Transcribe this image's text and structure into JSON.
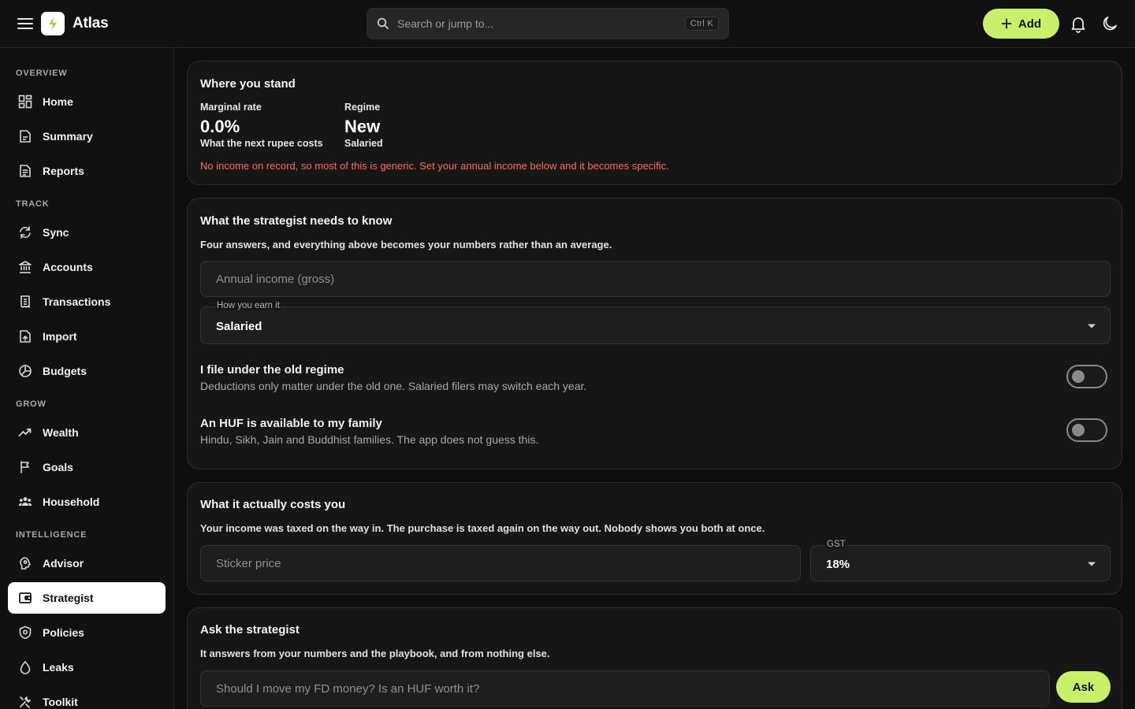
{
  "app": {
    "name": "Atlas",
    "search_placeholder": "Search or jump to...",
    "search_shortcut": "Ctrl K",
    "add_label": "Add"
  },
  "colors": {
    "accent": "#c8f06a",
    "warning": "#ff6b5b",
    "background": "#0e0e0e",
    "card": "#161616"
  },
  "sidebar": {
    "sections": [
      {
        "label": "OVERVIEW",
        "items": [
          {
            "label": "Home",
            "icon": "grid-icon"
          },
          {
            "label": "Summary",
            "icon": "document-icon"
          },
          {
            "label": "Reports",
            "icon": "report-icon"
          }
        ]
      },
      {
        "label": "TRACK",
        "items": [
          {
            "label": "Sync",
            "icon": "sync-icon"
          },
          {
            "label": "Accounts",
            "icon": "bank-icon"
          },
          {
            "label": "Transactions",
            "icon": "receipt-icon"
          },
          {
            "label": "Import",
            "icon": "import-icon"
          },
          {
            "label": "Budgets",
            "icon": "pie-icon"
          }
        ]
      },
      {
        "label": "GROW",
        "items": [
          {
            "label": "Wealth",
            "icon": "trend-icon"
          },
          {
            "label": "Goals",
            "icon": "flag-icon"
          },
          {
            "label": "Household",
            "icon": "people-icon"
          }
        ]
      },
      {
        "label": "INTELLIGENCE",
        "items": [
          {
            "label": "Advisor",
            "icon": "brain-icon"
          },
          {
            "label": "Strategist",
            "icon": "wallet-icon",
            "active": true
          },
          {
            "label": "Policies",
            "icon": "shield-icon"
          },
          {
            "label": "Leaks",
            "icon": "drop-icon"
          },
          {
            "label": "Toolkit",
            "icon": "tools-icon"
          }
        ]
      }
    ]
  },
  "stand": {
    "title": "Where you stand",
    "marginal_label": "Marginal rate",
    "marginal_value": "0.0%",
    "marginal_note": "What the next rupee costs",
    "regime_label": "Regime",
    "regime_value": "New",
    "regime_note": "Salaried",
    "warning": "No income on record, so most of this is generic. Set your annual income below and it becomes specific."
  },
  "needs": {
    "title": "What the strategist needs to know",
    "subtitle": "Four answers, and everything above becomes your numbers rather than an average.",
    "income_placeholder": "Annual income (gross)",
    "earn_label": "How you earn it",
    "earn_value": "Salaried",
    "old_regime_title": "I file under the old regime",
    "old_regime_desc": "Deductions only matter under the old one. Salaried filers may switch each year.",
    "old_regime_on": false,
    "huf_title": "An HUF is available to my family",
    "huf_desc": "Hindu, Sikh, Jain and Buddhist families. The app does not guess this.",
    "huf_on": false
  },
  "costs": {
    "title": "What it actually costs you",
    "subtitle": "Your income was taxed on the way in. The purchase is taxed again on the way out. Nobody shows you both at once.",
    "price_placeholder": "Sticker price",
    "gst_label": "GST",
    "gst_value": "18%"
  },
  "ask": {
    "title": "Ask the strategist",
    "subtitle": "It answers from your numbers and the playbook, and from nothing else.",
    "placeholder": "Should I move my FD money? Is an HUF worth it?",
    "button": "Ask"
  }
}
